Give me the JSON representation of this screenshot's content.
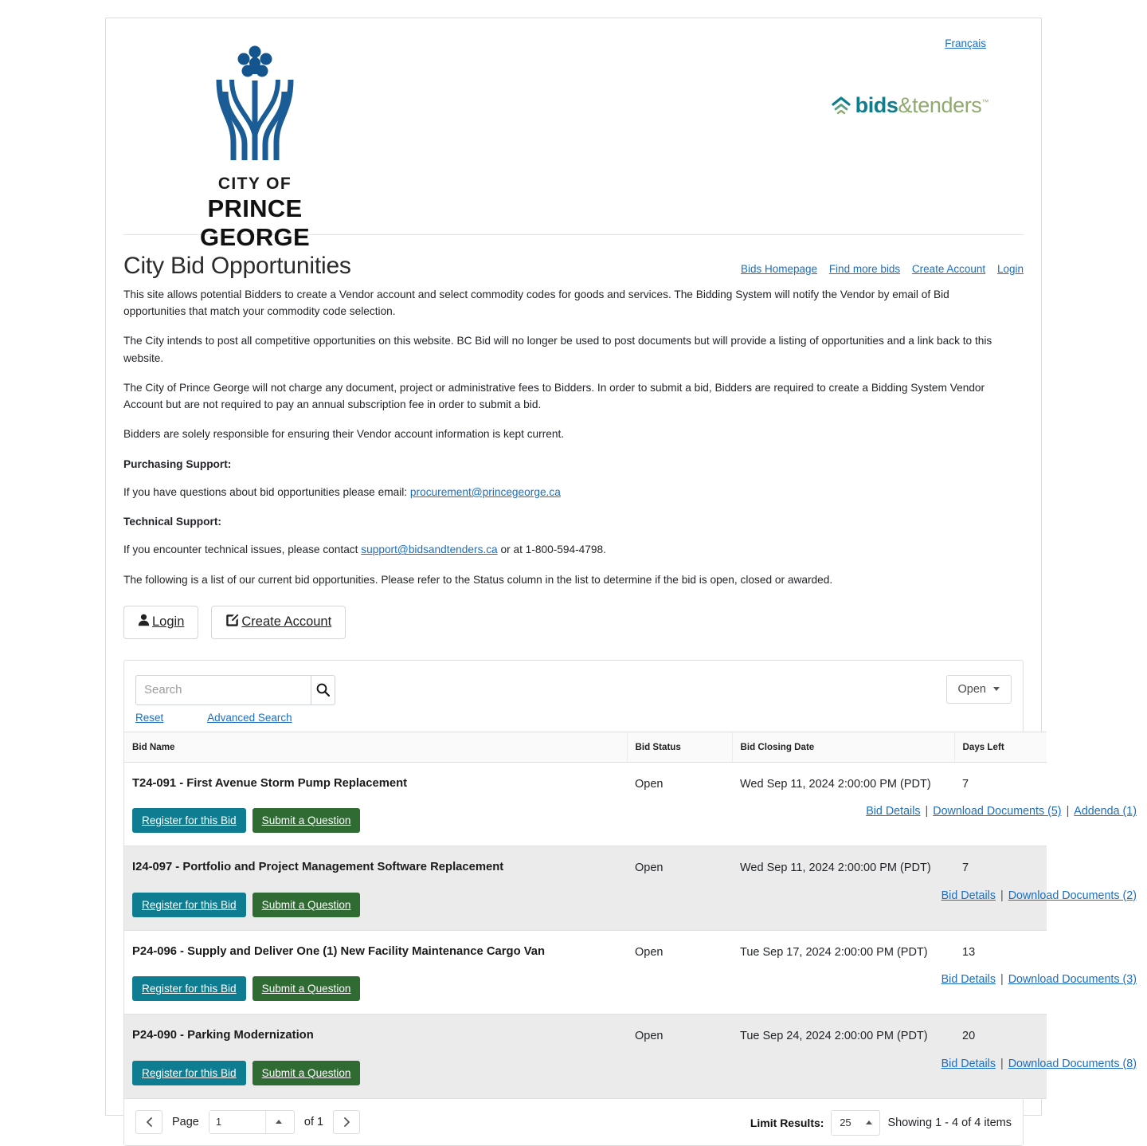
{
  "header": {
    "language_link": "Français",
    "city_logo": {
      "line1": "CITY OF",
      "line2": "PRINCE GEORGE"
    },
    "vendor_logo": {
      "part1": "bids",
      "part2": "&tenders",
      "tm": "™"
    }
  },
  "page": {
    "title": "City Bid Opportunities",
    "top_links": [
      {
        "label": "Bids Homepage"
      },
      {
        "label": "Find more bids"
      },
      {
        "label": "Create Account"
      },
      {
        "label": "Login"
      }
    ],
    "paragraphs": [
      "This site allows potential Bidders to create a Vendor account and  select commodity codes for goods and services. The Bidding System will notify the Vendor by email of Bid opportunities that match your commodity code selection.",
      "The City intends to post all competitive opportunities on this website. BC Bid will no longer be used to post documents but will provide a listing of opportunities and a link back to this website.",
      "The City of Prince George will not charge any document, project or administrative fees to Bidders. In order to submit a bid, Bidders are required to create a Bidding System Vendor Account but are not required to pay an annual subscription fee in order to submit a bid.",
      "Bidders are solely responsible for ensuring their Vendor account information is kept current."
    ],
    "purchasing_support_label": "Purchasing Support:",
    "purchasing_support_text_before": "If you have questions about bid opportunities please email: ",
    "purchasing_support_email": "procurement@princegeorge.ca ",
    "technical_support_label": "Technical Support:",
    "technical_support_text_before": "If you encounter technical issues, please contact ",
    "technical_support_email": "support@bidsandtenders.ca",
    "technical_support_text_after": " or at 1-800-594-4798.",
    "closing_note": "The following is a list of our current bid opportunities. Please refer to the Status column in the list to determine if the bid is open, closed or awarded."
  },
  "auth": {
    "login_label": "Login",
    "create_account_label": "Create Account"
  },
  "toolbar": {
    "search_placeholder": "Search",
    "search_value": "",
    "reset_label": "Reset",
    "advanced_search_label": "Advanced Search",
    "status_filter_value": "Open"
  },
  "table": {
    "headers": {
      "bid_name": "Bid Name",
      "bid_status": "Bid Status",
      "bid_closing_date": "Bid Closing Date",
      "days_left": "Days Left"
    },
    "register_label": "Register for this Bid",
    "question_label": "Submit a Question",
    "register_color": "#0f7d91",
    "question_color": "#2f6b33",
    "rows": [
      {
        "name": "T24-091 - First Avenue Storm Pump Replacement",
        "status": "Open",
        "closing_date": "Wed Sep 11, 2024 2:00:00 PM (PDT)",
        "days_left": "7",
        "links": [
          {
            "label": "Bid Details"
          },
          {
            "label": "Download Documents (5)"
          },
          {
            "label": "Addenda (1)"
          }
        ]
      },
      {
        "name": "I24-097 - Portfolio and Project Management Software Replacement",
        "status": "Open",
        "closing_date": "Wed Sep 11, 2024 2:00:00 PM (PDT)",
        "days_left": "7",
        "links": [
          {
            "label": "Bid Details"
          },
          {
            "label": "Download Documents (2)"
          }
        ]
      },
      {
        "name": "P24-096 - Supply and Deliver One (1) New Facility Maintenance Cargo Van",
        "status": "Open",
        "closing_date": "Tue Sep 17, 2024 2:00:00 PM (PDT)",
        "days_left": "13",
        "links": [
          {
            "label": "Bid Details"
          },
          {
            "label": "Download Documents (3)"
          }
        ]
      },
      {
        "name": "P24-090 - Parking Modernization",
        "status": "Open",
        "closing_date": "Tue Sep 24, 2024 2:00:00 PM (PDT)",
        "days_left": "20",
        "links": [
          {
            "label": "Bid Details"
          },
          {
            "label": "Download Documents (8)"
          }
        ]
      }
    ]
  },
  "pager": {
    "page_label": "Page",
    "page_value": "1",
    "of_label": "of 1",
    "limit_label": "Limit Results:",
    "limit_value": "25",
    "showing": "Showing 1 - 4 of 4 items"
  }
}
